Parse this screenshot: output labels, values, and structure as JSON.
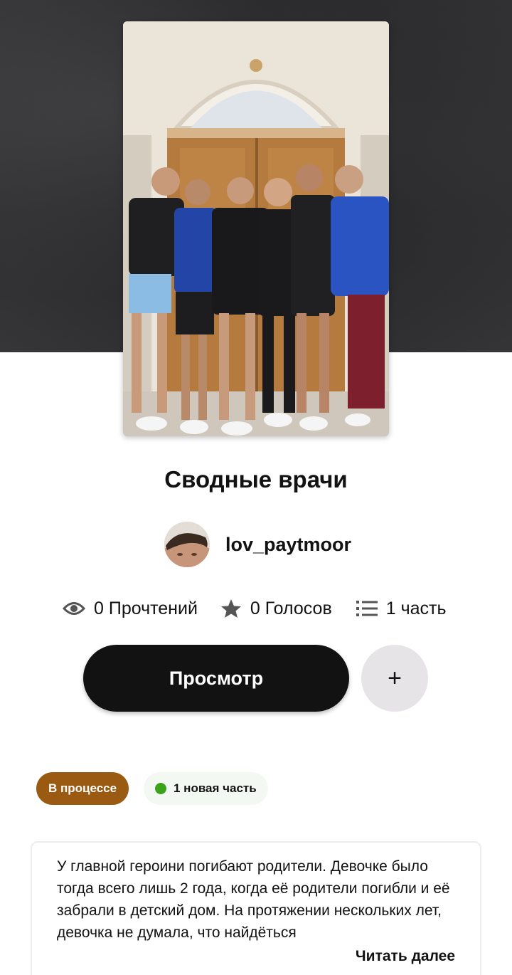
{
  "story": {
    "title": "Сводные врачи",
    "author": "lov_paytmoor"
  },
  "stats": {
    "reads": "0 Прочтений",
    "votes": "0 Голосов",
    "parts": "1 часть"
  },
  "actions": {
    "read_label": "Просмотр",
    "add_label": "+"
  },
  "badges": {
    "status": "В процессе",
    "new_part": "1 новая часть"
  },
  "description": {
    "text": "У главной героини погибают родители. Девочке было тогда всего лишь 2 года, когда её родители погибли и её забрали в детский дом. На протяжении нескольких лет, девочка не думала, что найдёться",
    "read_more": "Читать далее"
  },
  "colors": {
    "status_badge": "#9b5a12",
    "new_part_dot": "#3aa31a",
    "primary_button": "#121212",
    "secondary_button": "#e6e4e6"
  },
  "icons": {
    "reads": "eye-icon",
    "votes": "star-icon",
    "parts": "list-icon"
  }
}
